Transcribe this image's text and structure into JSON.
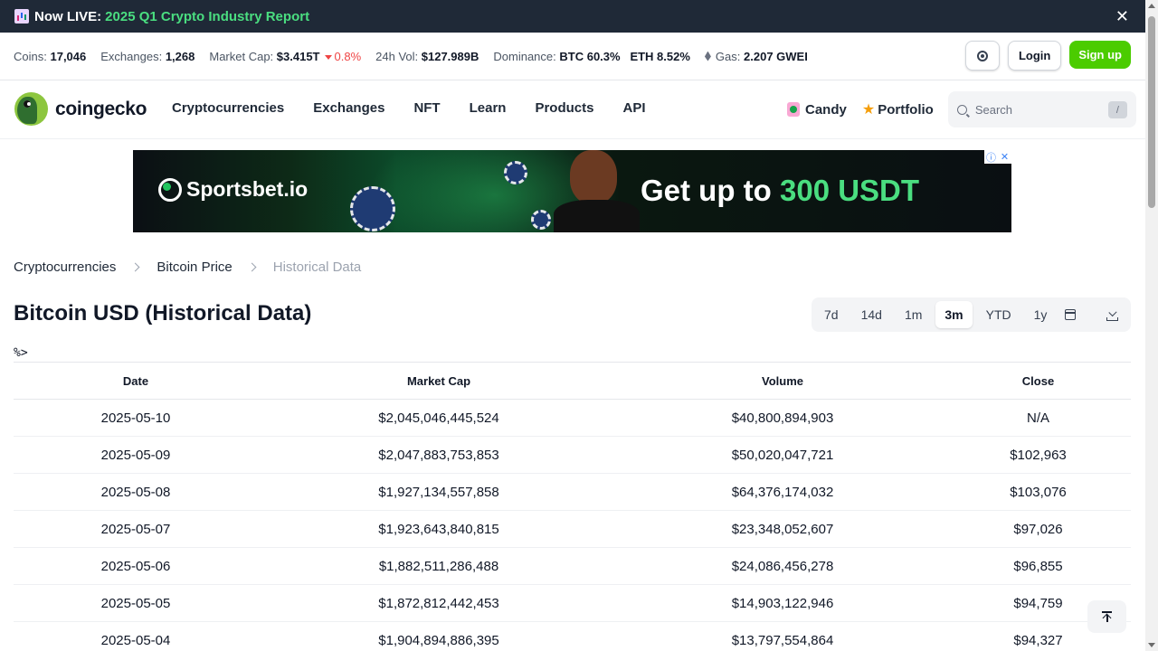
{
  "announcement": {
    "icon": "chart-icon",
    "prefix": "Now LIVE:",
    "link_text": "2025 Q1 Crypto Industry Report",
    "close_label": "✕"
  },
  "stats": {
    "coins_label": "Coins:",
    "coins_value": "17,046",
    "exchanges_label": "Exchanges:",
    "exchanges_value": "1,268",
    "market_cap_label": "Market Cap:",
    "market_cap_value": "$3.415T",
    "market_cap_change": "0.8%",
    "volume_label": "24h Vol:",
    "volume_value": "$127.989B",
    "dominance_label": "Dominance:",
    "dominance_btc": "BTC 60.3%",
    "dominance_eth": "ETH 8.52%",
    "gas_label": "Gas:",
    "gas_value": "2.207 GWEI",
    "login_label": "Login",
    "signup_label": "Sign up"
  },
  "nav": {
    "logo_text": "coingecko",
    "links": [
      "Cryptocurrencies",
      "Exchanges",
      "NFT",
      "Learn",
      "Products",
      "API"
    ],
    "candy_label": "Candy",
    "portfolio_label": "Portfolio",
    "search_placeholder": "Search",
    "search_shortcut": "/"
  },
  "ad": {
    "brand": "Sportsbet.io",
    "tagline_prefix": "Get up to ",
    "tagline_highlight": "300 USDT",
    "info_glyph": "ⓘ",
    "close_glyph": "✕"
  },
  "breadcrumb": [
    "Cryptocurrencies",
    "Bitcoin Price",
    "Historical Data"
  ],
  "page_title": "Bitcoin USD (Historical Data)",
  "range_buttons": [
    "7d",
    "14d",
    "1m",
    "3m",
    "YTD",
    "1y"
  ],
  "active_range": "3m",
  "stray_text": "%>",
  "table": {
    "headers": [
      "Date",
      "Market Cap",
      "Volume",
      "Close"
    ],
    "rows": [
      [
        "2025-05-10",
        "$2,045,046,445,524",
        "$40,800,894,903",
        "N/A"
      ],
      [
        "2025-05-09",
        "$2,047,883,753,853",
        "$50,020,047,721",
        "$102,963"
      ],
      [
        "2025-05-08",
        "$1,927,134,557,858",
        "$64,376,174,032",
        "$103,076"
      ],
      [
        "2025-05-07",
        "$1,923,643,840,815",
        "$23,348,052,607",
        "$97,026"
      ],
      [
        "2025-05-06",
        "$1,882,511,286,488",
        "$24,086,456,278",
        "$96,855"
      ],
      [
        "2025-05-05",
        "$1,872,812,442,453",
        "$14,903,122,946",
        "$94,759"
      ],
      [
        "2025-05-04",
        "$1,904,894,886,395",
        "$13,797,554,864",
        "$94,327"
      ]
    ]
  },
  "colors": {
    "accent_green": "#4bcc00",
    "announce_bg": "#1f2937",
    "negative": "#ef4444"
  }
}
